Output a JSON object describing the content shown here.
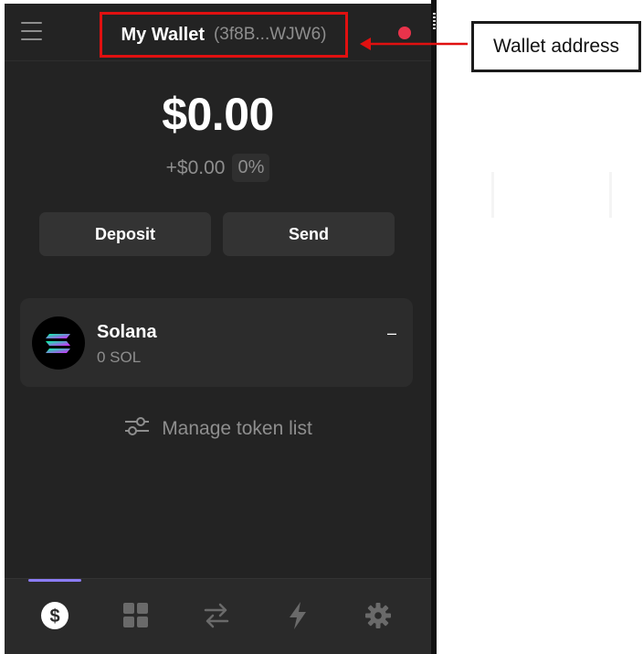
{
  "header": {
    "wallet_name": "My Wallet",
    "wallet_address": "(3f8B...WJW6)"
  },
  "balance": {
    "total": "$0.00",
    "change_value": "+$0.00",
    "change_percent": "0%"
  },
  "actions": {
    "deposit_label": "Deposit",
    "send_label": "Send"
  },
  "tokens": [
    {
      "name": "Solana",
      "amount": "0 SOL",
      "value": "–"
    }
  ],
  "manage": {
    "label": "Manage token list"
  },
  "nav": {
    "items": [
      {
        "icon": "dollar-icon",
        "active": true
      },
      {
        "icon": "grid-icon",
        "active": false
      },
      {
        "icon": "swap-icon",
        "active": false
      },
      {
        "icon": "lightning-icon",
        "active": false
      },
      {
        "icon": "gear-icon",
        "active": false
      }
    ]
  },
  "annotation": {
    "label": "Wallet address"
  },
  "colors": {
    "background": "#232323",
    "highlight_box": "#e01010",
    "status_dot": "#e9334b",
    "nav_indicator": "#8b7cf6"
  }
}
